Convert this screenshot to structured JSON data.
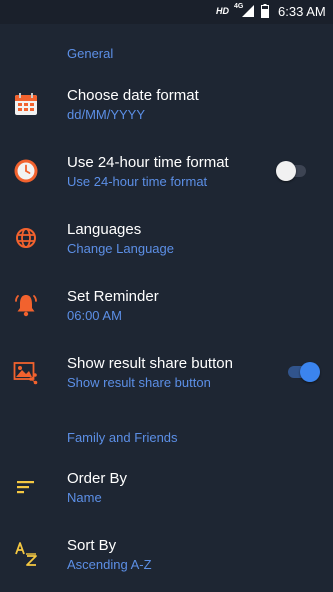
{
  "status_bar": {
    "hd": "HD",
    "network": "4G",
    "time": "6:33 AM"
  },
  "colors": {
    "background": "#1e2633",
    "accent": "#5c8fe6",
    "icon_orange": "#f2622e",
    "icon_yellow": "#f5c842"
  },
  "sections": {
    "general": "General",
    "family": "Family and Friends"
  },
  "settings": {
    "date_format": {
      "title": "Choose date format",
      "subtitle": "dd/MM/YYYY",
      "icon": "calendar-icon"
    },
    "time_format": {
      "title": "Use 24-hour time format",
      "subtitle": "Use 24-hour time format",
      "icon": "clock-icon",
      "enabled": false
    },
    "languages": {
      "title": "Languages",
      "subtitle": "Change Language",
      "icon": "globe-icon"
    },
    "reminder": {
      "title": "Set Reminder",
      "subtitle": "06:00 AM",
      "icon": "bell-icon"
    },
    "share": {
      "title": "Show result share button",
      "subtitle": "Show result share button",
      "icon": "image-share-icon",
      "enabled": true
    },
    "order_by": {
      "title": "Order By",
      "subtitle": "Name",
      "icon": "sort-lines-icon"
    },
    "sort_by": {
      "title": "Sort By",
      "subtitle": "Ascending A-Z",
      "icon": "az-sort-icon"
    }
  }
}
